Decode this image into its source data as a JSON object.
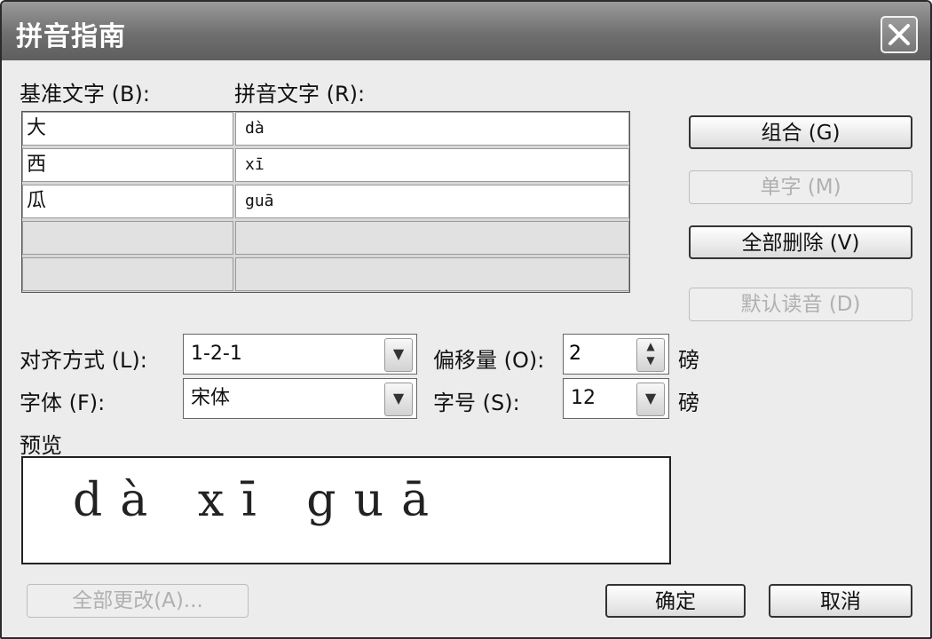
{
  "window": {
    "title": "拼音指南"
  },
  "labels": {
    "base_text": "基准文字 (B):",
    "ruby_text": "拼音文字 (R):",
    "alignment": "对齐方式 (L):",
    "offset": "偏移量 (O):",
    "font": "字体 (F):",
    "size": "字号 (S):",
    "unit": "磅",
    "preview": "预览"
  },
  "rows": [
    {
      "base": "大",
      "ruby": "dà"
    },
    {
      "base": "西",
      "ruby": "xī"
    },
    {
      "base": "瓜",
      "ruby": "guā"
    },
    {
      "base": "",
      "ruby": ""
    },
    {
      "base": "",
      "ruby": ""
    }
  ],
  "buttons": {
    "group": "组合 (G)",
    "mono": "单字 (M)",
    "clear_all": "全部删除 (V)",
    "default_reading": "默认读音 (D)",
    "change_all": "全部更改(A)...",
    "ok": "确定",
    "cancel": "取消"
  },
  "fields": {
    "alignment": "1-2-1",
    "offset": "2",
    "font": "宋体",
    "size": "12"
  },
  "preview": {
    "pinyin": "dà xī guā"
  }
}
